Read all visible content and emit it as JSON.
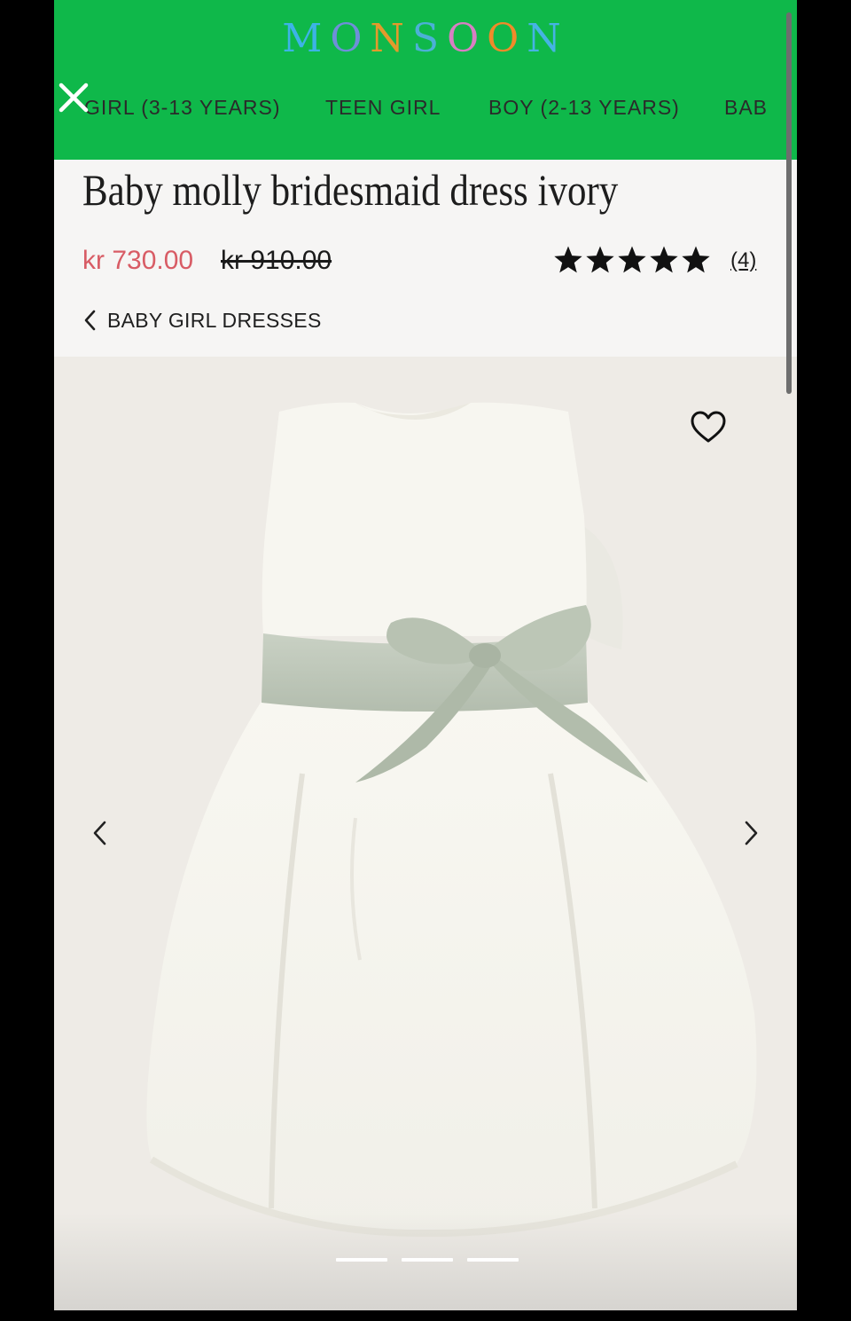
{
  "brand": {
    "letters": [
      {
        "char": "M",
        "color": "#3db3e6"
      },
      {
        "char": "O",
        "color": "#6f8fd9"
      },
      {
        "char": "N",
        "color": "#e29a2c"
      },
      {
        "char": "S",
        "color": "#4cb0d6"
      },
      {
        "char": "O",
        "color": "#d87fc3"
      },
      {
        "char": "O",
        "color": "#f08a2a"
      },
      {
        "char": "N",
        "color": "#46b3e3"
      }
    ],
    "header_color": "#0fb84a"
  },
  "nav": {
    "items": [
      {
        "label": "GIRL (3-13 YEARS)"
      },
      {
        "label": "TEEN GIRL"
      },
      {
        "label": "BOY (2-13 YEARS)"
      },
      {
        "label": "BAB"
      }
    ],
    "close_icon": "close-icon"
  },
  "product": {
    "title": "Baby molly bridesmaid dress ivory",
    "price_now": "kr 730.00",
    "price_was": "kr 910.00",
    "rating": 5,
    "rating_max": 5,
    "review_count": "(4)",
    "sale_color": "#d85c65"
  },
  "breadcrumb": {
    "label": "BABY GIRL DRESSES",
    "icon": "chevron-left-icon"
  },
  "gallery": {
    "image_count": 3,
    "active_index": 0,
    "wishlist_icon": "heart-icon",
    "prev_icon": "chevron-left-icon",
    "next_icon": "chevron-right-icon"
  }
}
